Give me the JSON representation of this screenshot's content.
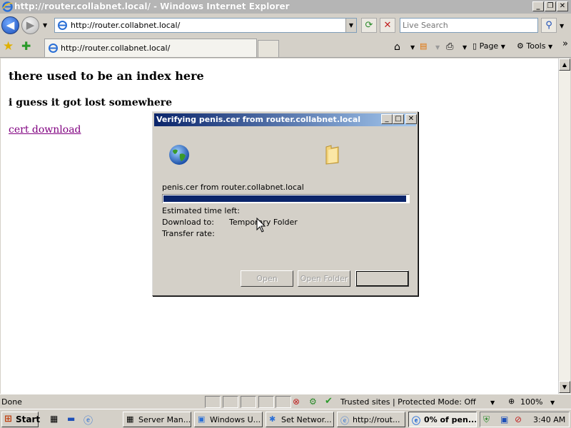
{
  "window": {
    "title": "http://router.collabnet.local/ - Windows Internet Explorer",
    "minimize": "_",
    "restore": "❐",
    "close": "✕"
  },
  "toolbar": {
    "address": "http://router.collabnet.local/",
    "search_placeholder": "Live Search",
    "tab_title": "http://router.collabnet.local/",
    "page_menu": "Page",
    "tools_menu": "Tools"
  },
  "content": {
    "heading1": "there used to be an index here",
    "heading2": "i guess it got lost somewhere",
    "link": "cert download"
  },
  "dialog": {
    "title": "Verifying penis.cer from router.collabnet.local",
    "file_line": "penis.cer from router.collabnet.local",
    "progress_fraction": 0.99,
    "estimated_label": "Estimated time left:",
    "download_to_label": "Download to:",
    "download_to_value": "Temporary Folder",
    "transfer_label": "Transfer rate:",
    "open_button": "Open",
    "open_folder_button": "Open Folder",
    "cancel_button": ""
  },
  "statusbar": {
    "status": "Done",
    "zone": "Trusted sites | Protected Mode: Off",
    "zoom": "100%"
  },
  "taskbar": {
    "start": "Start",
    "tasks": [
      {
        "label": "Server Man..."
      },
      {
        "label": "Windows U..."
      },
      {
        "label": "Set Networ..."
      },
      {
        "label": "http://rout..."
      },
      {
        "label": "0% of pen..."
      }
    ],
    "clock": "3:40 AM"
  }
}
